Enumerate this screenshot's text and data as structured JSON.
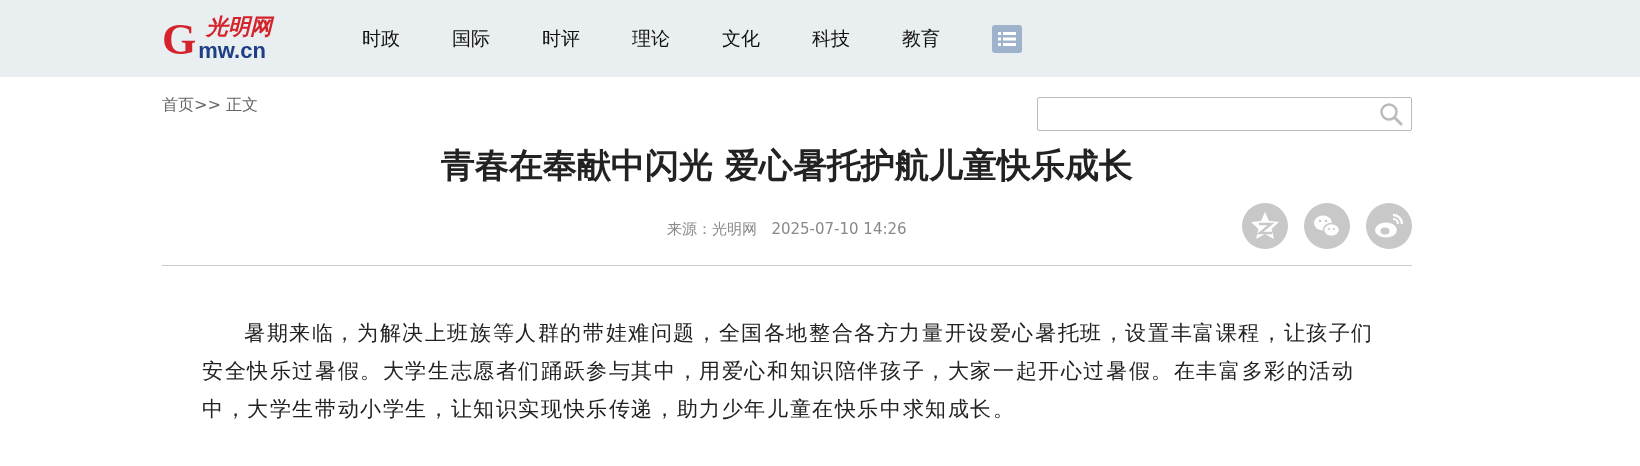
{
  "logo": {
    "mark": "G",
    "script": "光明网",
    "domain": "mw.cn"
  },
  "nav": [
    {
      "label": "时政"
    },
    {
      "label": "国际"
    },
    {
      "label": "时评"
    },
    {
      "label": "理论"
    },
    {
      "label": "文化"
    },
    {
      "label": "科技"
    },
    {
      "label": "教育"
    }
  ],
  "breadcrumb": "首页>> 正文",
  "article": {
    "title": "青春在奉献中闪光 爱心暑托护航儿童快乐成长",
    "source": "来源：光明网",
    "time": "2025-07-10 14:26",
    "paragraphs": [
      "暑期来临，为解决上班族等人群的带娃难问题，全国各地整合各方力量开设爱心暑托班，设置丰富课程，让孩子们安全快乐过暑假。大学生志愿者们踊跃参与其中，用爱心和知识陪伴孩子，大家一起开心过暑假。在丰富多彩的活动中，大学生带动小学生，让知识实现快乐传递，助力少年儿童在快乐中求知成长。"
    ]
  },
  "share": [
    {
      "kind": "qzone"
    },
    {
      "kind": "wechat"
    },
    {
      "kind": "weibo"
    }
  ]
}
